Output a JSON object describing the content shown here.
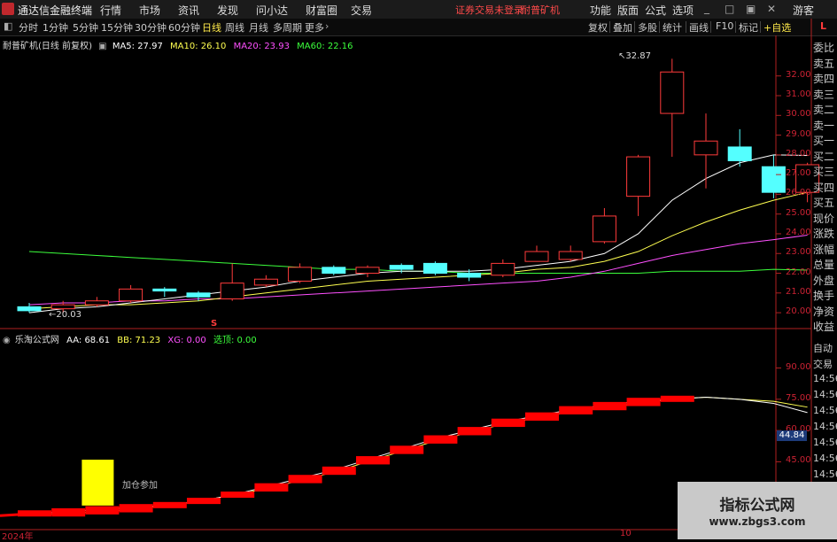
{
  "app": {
    "title": "通达信金融终端"
  },
  "menu": [
    "行情",
    "市场",
    "资讯",
    "发现",
    "问小达",
    "财富圈",
    "交易"
  ],
  "status": {
    "login": "证券交易未登录",
    "stock": "耐普矿机"
  },
  "menu_right": [
    "功能",
    "版面",
    "公式",
    "选项",
    "游客"
  ],
  "periods": [
    "分时",
    "1分钟",
    "5分钟",
    "15分钟",
    "30分钟",
    "60分钟",
    "日线",
    "周线",
    "月线",
    "多周期",
    "更多"
  ],
  "selected_period": "日线",
  "tools": [
    "复权",
    "叠加",
    "多股",
    "统计",
    "画线",
    "F10",
    "标记",
    "+自选"
  ],
  "close_label": "L",
  "main_legend": {
    "name": "耐普矿机(日线 前复权)",
    "ma5": "MA5: 27.97",
    "ma10": "MA10: 26.10",
    "ma20": "MA20: 23.93",
    "ma60": "MA60: 22.16"
  },
  "sub_legend": {
    "name": "乐淘公式网",
    "aa": "AA: 68.61",
    "bb": "BB: 71.23",
    "xg": "XG: 0.00",
    "xd": "选顶: 0.00"
  },
  "price_axis": [
    "32.00",
    "31.00",
    "30.00",
    "29.00",
    "28.00",
    "27.00",
    "26.00",
    "25.00",
    "24.00",
    "23.00",
    "22.00",
    "21.00",
    "20.00"
  ],
  "sub_axis": [
    "90.00",
    "75.00",
    "60.00",
    "45.00",
    "30.00"
  ],
  "sub_current": "44.84",
  "annotations": {
    "high": "32.87",
    "low": "20.03",
    "s_mark": "S",
    "sub_text": "加仓参加"
  },
  "date_axis": [
    "2024年",
    "10"
  ],
  "side_panel": [
    "委比",
    "卖五",
    "卖四",
    "卖三",
    "卖二",
    "卖一",
    "买一",
    "买二",
    "买三",
    "买四",
    "买五",
    "现价",
    "涨跌",
    "涨幅",
    "总量",
    "外盘",
    "换手",
    "净资",
    "收益"
  ],
  "side_panel2": [
    "自动",
    "交易",
    "14:56",
    "14:56",
    "14:56",
    "14:56",
    "14:56",
    "14:56",
    "14:56"
  ],
  "watermark": {
    "line1": "指标公式网",
    "line2": "www.zbgs3.com"
  },
  "colors": {
    "up": "#ff3b3b",
    "down": "#54ffff",
    "ma5": "#ffffff",
    "ma10": "#ffff50",
    "ma20": "#ff50ff",
    "ma60": "#3cff3c",
    "signal": "#ff0000",
    "highlight": "#ffff00"
  },
  "chart_data": [
    {
      "type": "candlestick",
      "ylim": [
        19.6,
        33.2
      ],
      "candles": [
        {
          "o": 20.3,
          "c": 20.1,
          "h": 20.5,
          "l": 20.0
        },
        {
          "o": 20.2,
          "c": 20.4,
          "h": 20.6,
          "l": 20.0
        },
        {
          "o": 20.4,
          "c": 20.6,
          "h": 20.8,
          "l": 20.3
        },
        {
          "o": 20.6,
          "c": 21.2,
          "h": 21.4,
          "l": 20.5
        },
        {
          "o": 21.2,
          "c": 21.1,
          "h": 21.3,
          "l": 20.8
        },
        {
          "o": 21.0,
          "c": 20.8,
          "h": 21.1,
          "l": 20.6
        },
        {
          "o": 20.7,
          "c": 21.5,
          "h": 22.5,
          "l": 20.6
        },
        {
          "o": 21.4,
          "c": 21.7,
          "h": 21.9,
          "l": 21.3
        },
        {
          "o": 21.6,
          "c": 22.3,
          "h": 22.5,
          "l": 21.5
        },
        {
          "o": 22.3,
          "c": 22.0,
          "h": 22.4,
          "l": 21.9
        },
        {
          "o": 22.0,
          "c": 22.3,
          "h": 22.4,
          "l": 21.8
        },
        {
          "o": 22.4,
          "c": 22.2,
          "h": 22.5,
          "l": 22.0
        },
        {
          "o": 22.5,
          "c": 22.0,
          "h": 22.6,
          "l": 21.9
        },
        {
          "o": 22.0,
          "c": 21.8,
          "h": 22.2,
          "l": 21.6
        },
        {
          "o": 21.9,
          "c": 22.5,
          "h": 22.7,
          "l": 21.8
        },
        {
          "o": 22.6,
          "c": 23.1,
          "h": 23.4,
          "l": 22.6
        },
        {
          "o": 22.7,
          "c": 23.1,
          "h": 23.4,
          "l": 22.6
        },
        {
          "o": 23.6,
          "c": 24.9,
          "h": 25.3,
          "l": 23.5
        },
        {
          "o": 25.9,
          "c": 27.9,
          "h": 28.0,
          "l": 24.9
        },
        {
          "o": 30.1,
          "c": 32.2,
          "h": 32.87,
          "l": 27.9
        },
        {
          "o": 28.0,
          "c": 28.7,
          "h": 30.1,
          "l": 26.3
        },
        {
          "o": 28.4,
          "c": 27.7,
          "h": 29.3,
          "l": 27.4
        },
        {
          "o": 27.4,
          "c": 26.1,
          "h": 28.0,
          "l": 25.8
        },
        {
          "o": 26.1,
          "c": 27.5,
          "h": 27.6,
          "l": 25.6
        }
      ],
      "ma5": [
        20.0,
        20.2,
        20.3,
        20.5,
        20.7,
        20.9,
        21.1,
        21.3,
        21.6,
        21.8,
        22.0,
        22.1,
        22.1,
        22.1,
        22.2,
        22.4,
        22.6,
        23.0,
        24.0,
        25.7,
        26.8,
        27.6,
        28.0,
        27.97
      ],
      "ma10": [
        20.2,
        20.3,
        20.4,
        20.4,
        20.5,
        20.6,
        20.8,
        21.0,
        21.2,
        21.4,
        21.6,
        21.7,
        21.8,
        21.9,
        22.0,
        22.2,
        22.3,
        22.6,
        23.1,
        23.9,
        24.6,
        25.2,
        25.7,
        26.1
      ],
      "ma20": [
        20.4,
        20.5,
        20.5,
        20.6,
        20.6,
        20.7,
        20.7,
        20.8,
        20.9,
        21.0,
        21.1,
        21.2,
        21.3,
        21.4,
        21.5,
        21.6,
        21.8,
        22.1,
        22.5,
        22.9,
        23.2,
        23.5,
        23.7,
        23.93
      ],
      "ma60": [
        23.1,
        23.0,
        22.9,
        22.8,
        22.7,
        22.6,
        22.5,
        22.4,
        22.3,
        22.2,
        22.2,
        22.1,
        22.1,
        22.0,
        22.0,
        22.0,
        22.0,
        22.0,
        22.0,
        22.1,
        22.1,
        22.1,
        22.2,
        22.16
      ]
    },
    {
      "type": "indicator",
      "ylim": [
        15,
        100
      ],
      "aa": [
        20,
        21,
        22,
        23,
        24,
        26,
        29,
        33,
        37,
        41,
        46,
        51,
        56,
        60,
        64,
        67,
        70,
        72,
        74,
        75,
        76,
        75,
        73,
        68.61
      ],
      "bb": [
        20,
        20,
        21,
        22,
        24,
        26,
        29,
        32,
        36,
        40,
        45,
        50,
        55,
        59,
        63,
        66,
        69,
        71,
        73,
        75,
        76,
        75,
        74,
        71.23
      ],
      "highlight": {
        "index": 2,
        "low": 24,
        "high": 46
      }
    }
  ]
}
